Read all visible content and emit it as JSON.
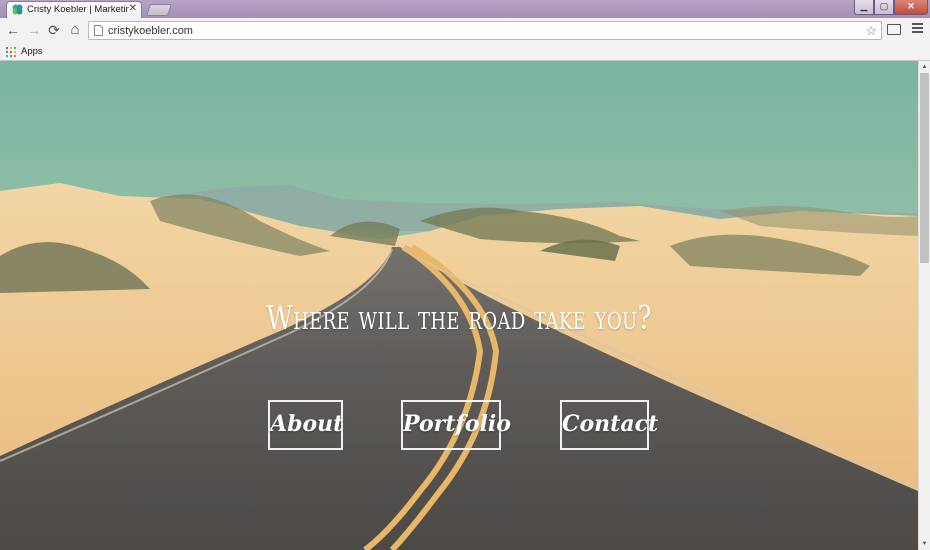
{
  "browser": {
    "tab_title": "Cristy Koebler | Marketing",
    "tab_close": "✕",
    "url": "cristykoebler.com",
    "nav": {
      "back": "←",
      "forward": "→",
      "reload": "⟳",
      "home": "⌂",
      "star": "☆"
    },
    "window_controls": {
      "minimize": "▁",
      "maximize": "▢",
      "close": "✕"
    },
    "bookmarks": {
      "apps_label": "Apps"
    }
  },
  "hero": {
    "title": "Where will the road take you?",
    "buttons": {
      "about": "About",
      "portfolio": "Portfolio",
      "contact": "Contact"
    }
  },
  "scrollbar": {
    "up": "▲",
    "down": "▼"
  },
  "colors": {
    "sky": "#7cbaa7",
    "sand": "#f4cf97",
    "road": "#4a4a4d",
    "lines": "#e6b060"
  }
}
